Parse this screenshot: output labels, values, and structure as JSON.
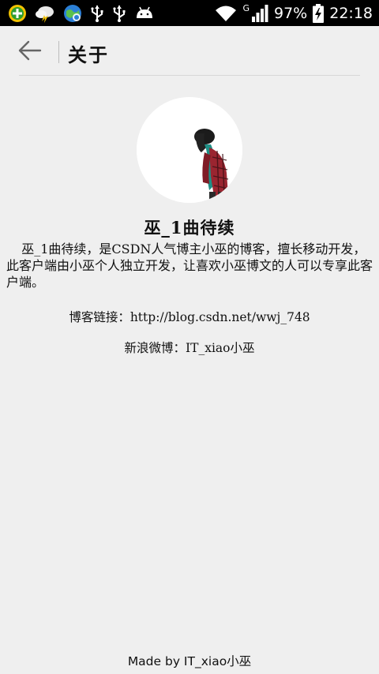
{
  "status_bar": {
    "left_icons": [
      "app-notification-icon",
      "weather-icon",
      "browser-icon",
      "usb-icon",
      "usb-icon",
      "android-icon"
    ],
    "network": "G",
    "battery": "97%",
    "time": "22:18"
  },
  "appbar": {
    "title": "关于",
    "back_icon": "arrow-left-icon"
  },
  "profile": {
    "name": "巫_1曲待续",
    "intro": "巫_1曲待续，是CSDN人气博主小巫的博客，擅长移动开发，此客户端由小巫个人独立开发，让喜欢小巫博文的人可以专享此客户端。",
    "blog_label": "博客链接：",
    "blog_url": "http://blog.csdn.net/wwj_748",
    "weibo_label": "新浪微博：",
    "weibo_value": "IT_xiao小巫"
  },
  "footer": {
    "text": "Made by IT_xiao小巫"
  }
}
